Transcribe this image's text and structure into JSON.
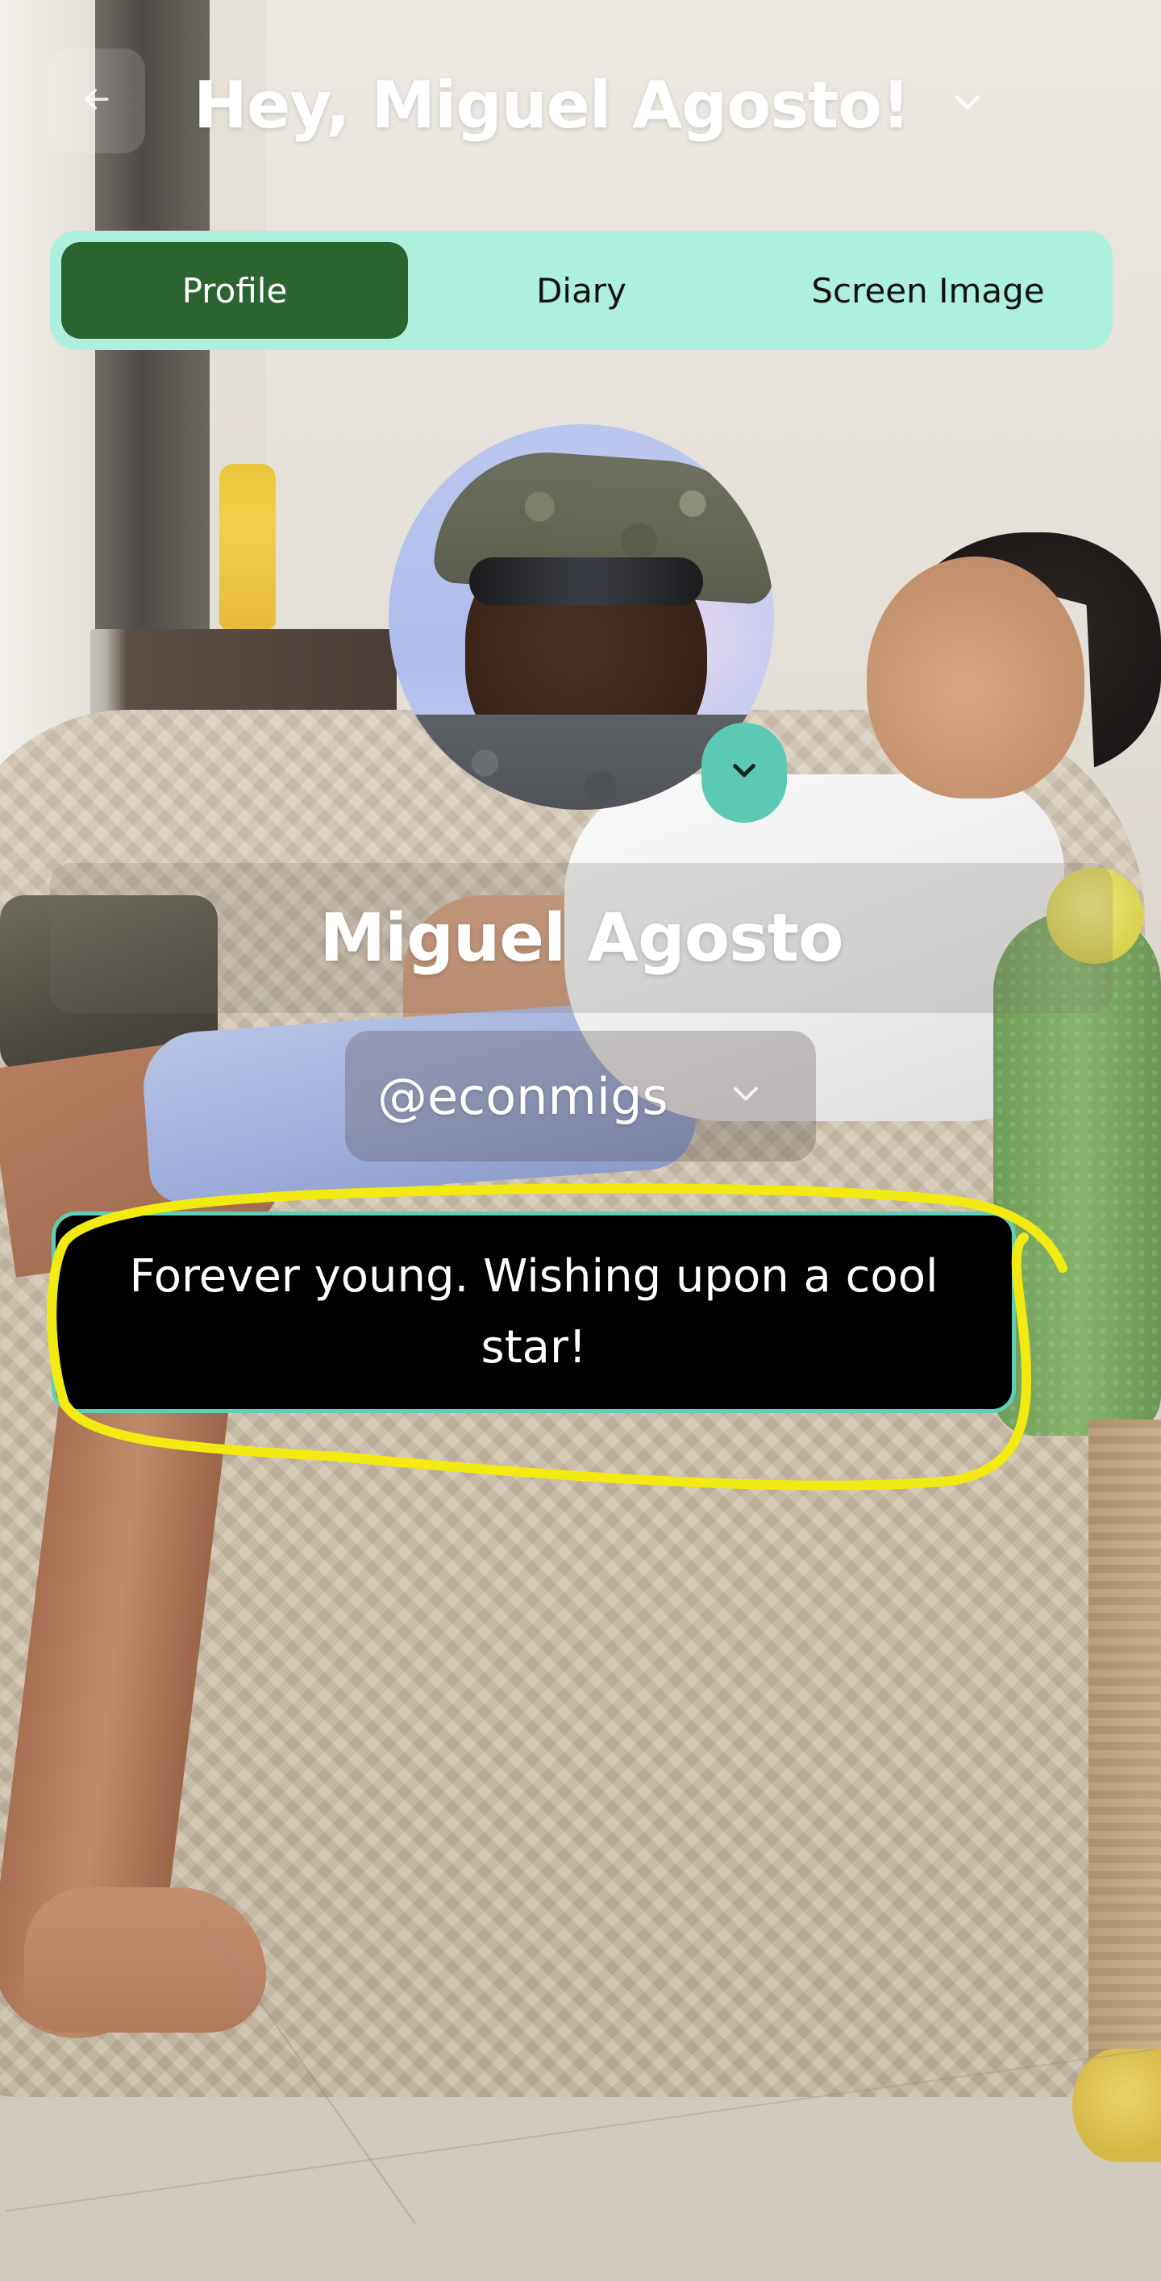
{
  "header": {
    "greeting": "Hey, Miguel Agosto!",
    "back_icon": "arrow-left-icon",
    "menu_icon": "chevron-down-icon"
  },
  "tabs": [
    {
      "label": "Profile",
      "active": true
    },
    {
      "label": "Diary",
      "active": false
    },
    {
      "label": "Screen Image",
      "active": false
    }
  ],
  "profile": {
    "display_name": "Miguel Agosto",
    "username": "@econmigs",
    "bio": "Forever young. Wishing upon a cool star!",
    "avatar_toggle_icon": "chevron-down-icon"
  },
  "colors": {
    "tab_bar_bg": "#aef0de",
    "tab_active_bg": "#2c6431",
    "accent": "#5cc9b4",
    "bio_border": "#62cdb6",
    "highlight_stroke": "#f2ea11"
  }
}
